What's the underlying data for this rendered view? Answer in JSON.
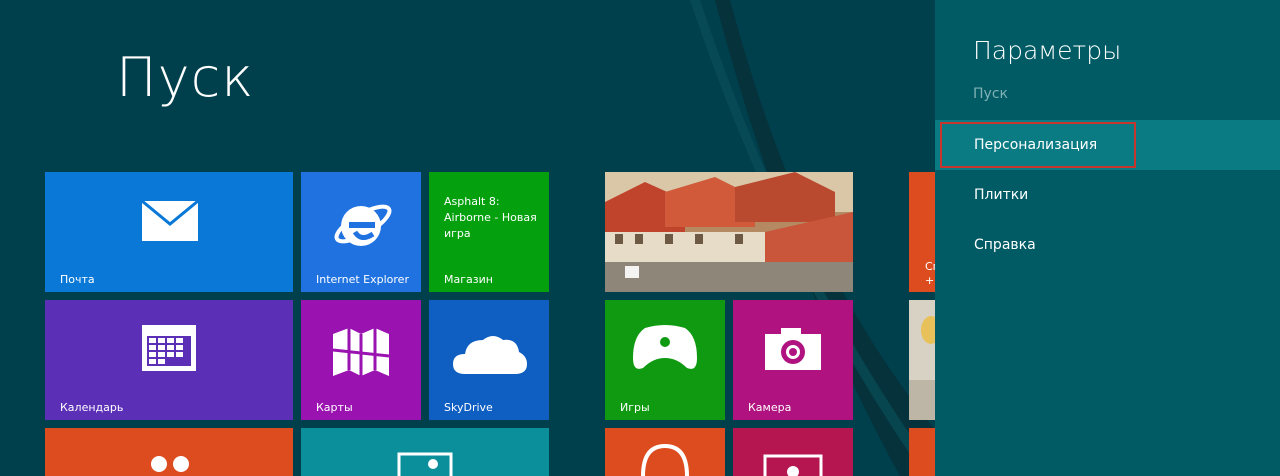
{
  "start": {
    "title": "Пуск"
  },
  "tiles": {
    "mail": {
      "label": "Почта"
    },
    "ie": {
      "label": "Internet Explorer"
    },
    "store": {
      "label": "Магазин",
      "promo": "Asphalt 8: Airborne - Новая игра"
    },
    "calendar": {
      "label": "Календарь"
    },
    "maps": {
      "label": "Карты"
    },
    "skydrive": {
      "label": "SkyDrive"
    },
    "games": {
      "label": "Игры"
    },
    "camera": {
      "label": "Камера"
    },
    "partial_top_text": "Сп\n+"
  },
  "charm": {
    "title": "Параметры",
    "context": "Пуск",
    "items": [
      {
        "label": "Персонализация",
        "active": true
      },
      {
        "label": "Плитки"
      },
      {
        "label": "Справка"
      }
    ]
  },
  "colors": {
    "background": "#003f4c",
    "charm_bg": "#005b64",
    "charm_active": "#0a7b83",
    "mail": "#0a78d6",
    "ie": "#1f72e0",
    "store": "#05a00e",
    "calendar": "#5b2fb6",
    "maps": "#9a12b0",
    "skydrive": "#0f5ec2",
    "games": "#109a12",
    "camera": "#b0137f",
    "orange": "#dd4c1f",
    "teal": "#0a8f9b",
    "crimson": "#b51650"
  }
}
